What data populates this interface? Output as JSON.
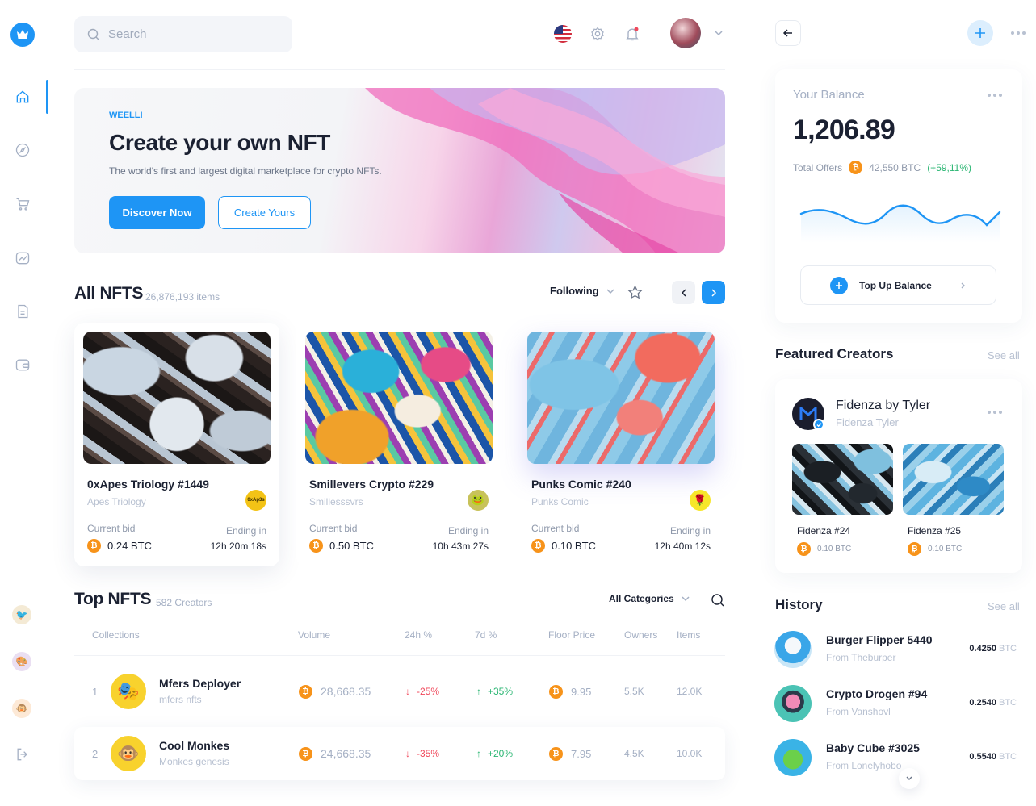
{
  "search": {
    "placeholder": "Search"
  },
  "hero": {
    "brand": "WEELLI",
    "title": "Create your own NFT",
    "subtitle": "The world's first and largest digital marketplace for crypto NFTs.",
    "primary_button": "Discover Now",
    "secondary_button": "Create Yours"
  },
  "all_nfts": {
    "title": "All NFTS",
    "count": "26,876,193 items",
    "filter": "Following",
    "cards": [
      {
        "name": "0xApes Triology #1449",
        "creator": "Apes Triology",
        "avatar_label": "0xAp3s",
        "current_bid_label": "Current bid",
        "price": "0.24 BTC",
        "ending_label": "Ending in",
        "time": "12h 20m 18s"
      },
      {
        "name": "Smillevers Crypto #229",
        "creator": "Smillesssvrs",
        "current_bid_label": "Current bid",
        "price": "0.50 BTC",
        "ending_label": "Ending in",
        "time": "10h 43m 27s"
      },
      {
        "name": "Punks Comic #240",
        "creator": "Punks Comic",
        "current_bid_label": "Current bid",
        "price": "0.10 BTC",
        "ending_label": "Ending in",
        "time": "12h 40m 12s"
      }
    ]
  },
  "top_nfts": {
    "title": "Top NFTS",
    "count": "582 Creators",
    "filter": "All Categories",
    "columns": [
      "Collections",
      "Volume",
      "24h %",
      "7d %",
      "Floor Price",
      "Owners",
      "Items"
    ],
    "rows": [
      {
        "rank": "1",
        "name": "Mfers Deployer",
        "sub": "mfers nfts",
        "volume": "28,668.35",
        "d24": "-25%",
        "d7": "+35%",
        "floor": "9.95",
        "owners": "5.5K",
        "items": "12.0K"
      },
      {
        "rank": "2",
        "name": "Cool Monkes",
        "sub": "Monkes genesis",
        "volume": "24,668.35",
        "d24": "-35%",
        "d7": "+20%",
        "floor": "7.95",
        "owners": "4.5K",
        "items": "10.0K"
      }
    ]
  },
  "balance": {
    "label": "Your Balance",
    "amount": "1,206.89",
    "offers_label": "Total Offers",
    "offers_value": "42,550 BTC",
    "offers_change": "(+59,11%)",
    "top_up": "Top Up Balance"
  },
  "featured": {
    "title": "Featured Creators",
    "see_all": "See all",
    "creator_name": "Fidenza by Tyler",
    "creator_sub": "Fidenza Tyler",
    "items": [
      {
        "name": "Fidenza #24",
        "price": "0.10 BTC"
      },
      {
        "name": "Fidenza #25",
        "price": "0.10 BTC"
      }
    ]
  },
  "history": {
    "title": "History",
    "see_all": "See all",
    "unit": "BTC",
    "items": [
      {
        "title": "Burger Flipper 5440",
        "sub": "From Theburper",
        "value": "0.4250"
      },
      {
        "title": "Crypto Drogen #94",
        "sub": "From Vanshovl",
        "value": "0.2540"
      },
      {
        "title": "Baby Cube #3025",
        "sub": "From Lonelyhobo",
        "value": "0.5540"
      }
    ]
  },
  "colors": {
    "accent": "#1e95f5",
    "positive": "#2bb673",
    "negative": "#f0485b",
    "btc": "#f7931a"
  }
}
